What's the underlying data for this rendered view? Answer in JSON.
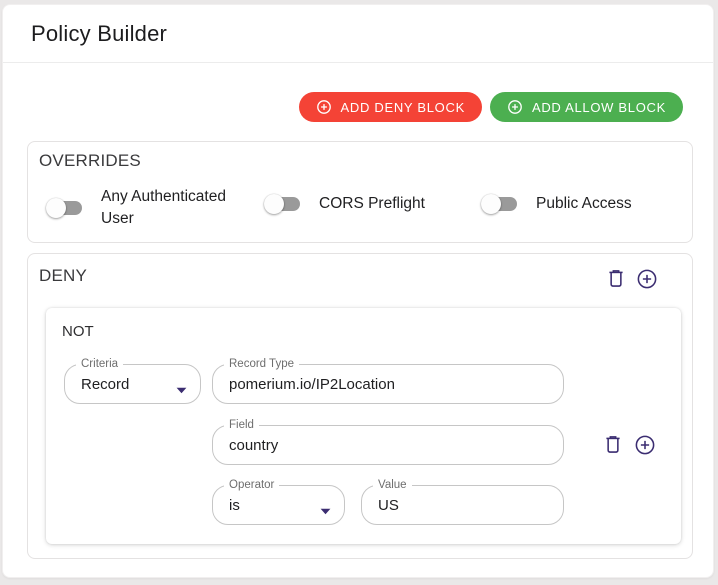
{
  "header": {
    "title": "Policy Builder"
  },
  "toolbar": {
    "add_deny_label": "ADD DENY BLOCK",
    "add_allow_label": "ADD ALLOW BLOCK",
    "deny_color": "#f44336",
    "allow_color": "#4caf50"
  },
  "overrides": {
    "title": "OVERRIDES",
    "toggles": [
      {
        "label": "Any Authenticated User",
        "state": "off"
      },
      {
        "label": "CORS Preflight",
        "state": "off"
      },
      {
        "label": "Public Access",
        "state": "off"
      }
    ]
  },
  "deny_block": {
    "title": "DENY",
    "group_label": "NOT",
    "criteria": {
      "label": "Criteria",
      "value": "Record"
    },
    "record_type": {
      "label": "Record Type",
      "value": "pomerium.io/IP2Location"
    },
    "field": {
      "label": "Field",
      "value": "country"
    },
    "operator": {
      "label": "Operator",
      "value": "is"
    },
    "value": {
      "label": "Value",
      "value": "US"
    }
  },
  "icons": {
    "add": "plus-circle",
    "delete": "trash",
    "select_arrow": "caret-down"
  },
  "colors": {
    "accent_purple": "#3b2d71",
    "deny_red": "#f44336",
    "allow_green": "#4caf50",
    "toggle_track_gray": "#9a9a9a"
  }
}
